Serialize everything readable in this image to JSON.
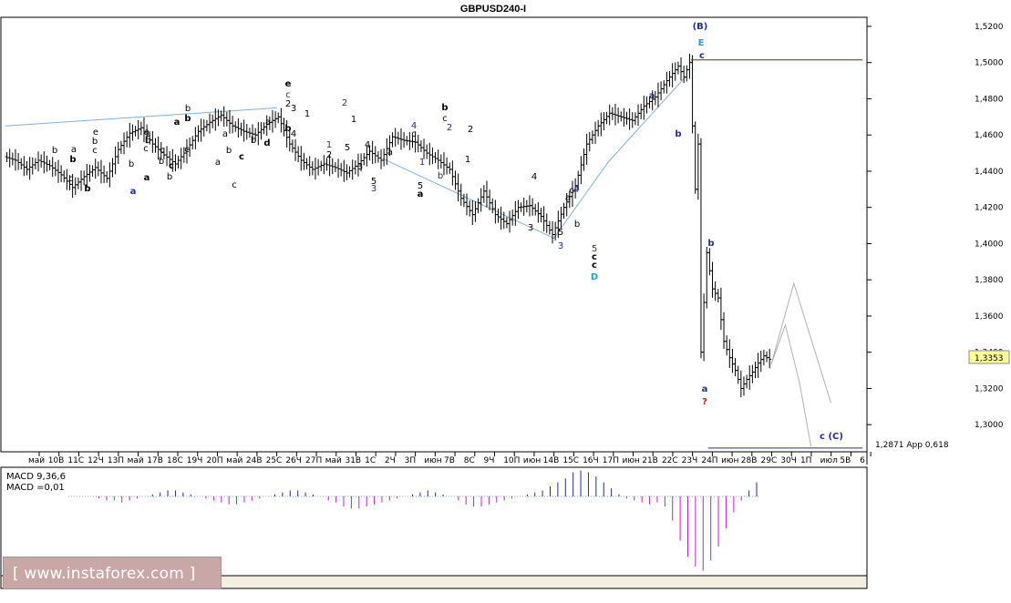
{
  "title": "GBPUSD240-I",
  "price_axis": {
    "ticks": [
      "1,5200",
      "1,5000",
      "1,4800",
      "1,4600",
      "1,4400",
      "1,4200",
      "1,4000",
      "1,3800",
      "1,3600",
      "1,3400",
      "1,3200",
      "1,3000"
    ],
    "current_price": "1,3353"
  },
  "target_label": "1,2871 App 0,618",
  "time_axis": [
    "май",
    "10B",
    "11C",
    "12Ч",
    "13П",
    "май",
    "17B",
    "18C",
    "19Ч",
    "20П",
    "май",
    "24B",
    "25C",
    "26Ч",
    "27П",
    "май",
    "31B",
    "1C",
    "2Ч",
    "3П",
    "июн",
    "7B",
    "8C",
    "9Ч",
    "10П",
    "июн",
    "14B",
    "15C",
    "16Ч",
    "17П",
    "июн",
    "21B",
    "22C",
    "23Ч",
    "24П",
    "июн",
    "28B",
    "29C",
    "30Ч",
    "1П",
    "июл",
    "5B",
    "6"
  ],
  "macd": {
    "label1": "MACD 9,36,6",
    "label2": "MACD =0,01"
  },
  "watermark": "[  www.instaforex.com ]",
  "colors": {
    "background": "#ffffff",
    "wave_blue": "#1f2f8f",
    "wave_dark": "#000000",
    "wave_cyan": "#2aa0c8",
    "question": "#c0201e",
    "resistance_line": "#a01010",
    "macd_neg": "#c020c0",
    "macd_pos": "#1f2f8f"
  },
  "wave_labels": [
    {
      "t": "(B)",
      "c": "wave_blue",
      "b": true
    },
    {
      "t": "E",
      "c": "wave_cyan",
      "b": true
    },
    {
      "t": "c",
      "c": "wave_blue",
      "b": true
    },
    {
      "t": "D",
      "c": "wave_cyan",
      "b": true
    },
    {
      "t": "c",
      "c": "wave_dark",
      "b": true
    },
    {
      "t": "c",
      "c": "wave_dark",
      "b": true
    },
    {
      "t": "5",
      "c": "wave_blue",
      "b": false
    },
    {
      "t": "a",
      "c": "wave_blue",
      "b": true
    },
    {
      "t": "?",
      "c": "question",
      "b": true
    },
    {
      "t": "b",
      "c": "wave_blue",
      "b": true
    },
    {
      "t": "c (C)",
      "c": "wave_blue",
      "b": true
    },
    {
      "t": "a",
      "c": "wave_blue",
      "b": true
    },
    {
      "t": "b",
      "c": "wave_blue",
      "b": true
    },
    {
      "t": "4",
      "c": "wave_blue",
      "b": false
    },
    {
      "t": "3",
      "c": "wave_blue",
      "b": false
    },
    {
      "t": "3",
      "c": "wave_dark",
      "b": false
    },
    {
      "t": "5",
      "c": "wave_dark",
      "b": false
    },
    {
      "t": "4",
      "c": "wave_dark",
      "b": false
    },
    {
      "t": "a",
      "c": "wave_dark",
      "b": false
    },
    {
      "t": "b",
      "c": "wave_dark",
      "b": false
    },
    {
      "t": "c",
      "c": "wave_dark",
      "b": false
    },
    {
      "t": "b",
      "c": "wave_dark",
      "b": true
    },
    {
      "t": "c",
      "c": "wave_dark",
      "b": false
    },
    {
      "t": "2",
      "c": "wave_blue",
      "b": false
    },
    {
      "t": "2",
      "c": "wave_dark",
      "b": false
    },
    {
      "t": "1",
      "c": "wave_dark",
      "b": false
    },
    {
      "t": "1",
      "c": "wave_blue",
      "b": false
    },
    {
      "t": "b",
      "c": "wave_blue",
      "b": false
    },
    {
      "t": "4",
      "c": "wave_blue",
      "b": false
    },
    {
      "t": "c",
      "c": "wave_dark",
      "b": false
    },
    {
      "t": "5",
      "c": "wave_dark",
      "b": false
    },
    {
      "t": "a",
      "c": "wave_dark",
      "b": true
    },
    {
      "t": "4",
      "c": "wave_dark",
      "b": false
    },
    {
      "t": "a",
      "c": "wave_dark",
      "b": false
    },
    {
      "t": "3",
      "c": "wave_dark",
      "b": false
    },
    {
      "t": "5",
      "c": "wave_dark",
      "b": false
    },
    {
      "t": "3",
      "c": "wave_blue",
      "b": false
    },
    {
      "t": "2",
      "c": "wave_blue",
      "b": false
    },
    {
      "t": "1",
      "c": "wave_dark",
      "b": false
    },
    {
      "t": "5",
      "c": "wave_dark",
      "b": false
    },
    {
      "t": "1",
      "c": "wave_blue",
      "b": false
    },
    {
      "t": "2",
      "c": "wave_dark",
      "b": false
    },
    {
      "t": "3",
      "c": "wave_dark",
      "b": false
    },
    {
      "t": "4",
      "c": "wave_dark",
      "b": false
    },
    {
      "t": "1",
      "c": "wave_dark",
      "b": false
    },
    {
      "t": "b",
      "c": "wave_dark",
      "b": true
    },
    {
      "t": "e",
      "c": "wave_dark",
      "b": true
    },
    {
      "t": "c",
      "c": "wave_blue",
      "b": false
    },
    {
      "t": "2",
      "c": "wave_dark",
      "b": false
    },
    {
      "t": "a",
      "c": "wave_dark",
      "b": false
    },
    {
      "t": "b",
      "c": "wave_dark",
      "b": false
    },
    {
      "t": "d",
      "c": "wave_dark",
      "b": true
    },
    {
      "t": "c",
      "c": "wave_dark",
      "b": false
    },
    {
      "t": "c",
      "c": "wave_dark",
      "b": true
    },
    {
      "t": "a",
      "c": "wave_dark",
      "b": false
    },
    {
      "t": "b",
      "c": "wave_dark",
      "b": false
    },
    {
      "t": "a",
      "c": "wave_dark",
      "b": false
    },
    {
      "t": "b",
      "c": "wave_dark",
      "b": false
    },
    {
      "t": "b",
      "c": "wave_dark",
      "b": true
    },
    {
      "t": "a",
      "c": "wave_dark",
      "b": true
    },
    {
      "t": "c",
      "c": "wave_dark",
      "b": false
    },
    {
      "t": "b",
      "c": "wave_dark",
      "b": false
    },
    {
      "t": "c",
      "c": "wave_dark",
      "b": true
    },
    {
      "t": "a",
      "c": "wave_blue",
      "b": true
    },
    {
      "t": "b",
      "c": "wave_dark",
      "b": false
    },
    {
      "t": "c",
      "c": "wave_dark",
      "b": false
    },
    {
      "t": "a",
      "c": "wave_dark",
      "b": false
    },
    {
      "t": "b",
      "c": "wave_dark",
      "b": false
    },
    {
      "t": "a",
      "c": "wave_dark",
      "b": true
    },
    {
      "t": "b",
      "c": "wave_dark",
      "b": false
    },
    {
      "t": "c",
      "c": "wave_dark",
      "b": false
    },
    {
      "t": "e",
      "c": "wave_dark",
      "b": false
    },
    {
      "t": "b",
      "c": "wave_dark",
      "b": false
    },
    {
      "t": "c",
      "c": "wave_dark",
      "b": false
    },
    {
      "t": "b",
      "c": "wave_dark",
      "b": true
    },
    {
      "t": "a",
      "c": "wave_dark",
      "b": false
    },
    {
      "t": "b",
      "c": "wave_dark",
      "b": true
    },
    {
      "t": "c",
      "c": "wave_dark",
      "b": false
    },
    {
      "t": "b",
      "c": "wave_dark",
      "b": false
    }
  ],
  "chart_data": {
    "type": "candlestick-ohlc",
    "title": "GBPUSD240-I",
    "timeframe": "H4",
    "y_range": [
      1.285,
      1.525
    ],
    "price_ticks": [
      1.52,
      1.5,
      1.48,
      1.46,
      1.44,
      1.42,
      1.4,
      1.38,
      1.36,
      1.34,
      1.32,
      1.3
    ],
    "last_price": 1.3353,
    "key_levels": [
      {
        "price": 1.5015,
        "role": "wave (B) high"
      },
      {
        "price": 1.2871,
        "label": "1,2871 App 0,618"
      }
    ],
    "path_points": [
      {
        "x": 0,
        "y": 1.448
      },
      {
        "x": 4,
        "y": 1.446
      },
      {
        "x": 8,
        "y": 1.441
      },
      {
        "x": 12,
        "y": 1.446
      },
      {
        "x": 16,
        "y": 1.443
      },
      {
        "x": 20,
        "y": 1.438
      },
      {
        "x": 24,
        "y": 1.431
      },
      {
        "x": 28,
        "y": 1.437
      },
      {
        "x": 32,
        "y": 1.442
      },
      {
        "x": 36,
        "y": 1.436
      },
      {
        "x": 40,
        "y": 1.452
      },
      {
        "x": 44,
        "y": 1.461
      },
      {
        "x": 48,
        "y": 1.464
      },
      {
        "x": 52,
        "y": 1.455
      },
      {
        "x": 56,
        "y": 1.449
      },
      {
        "x": 60,
        "y": 1.444
      },
      {
        "x": 64,
        "y": 1.452
      },
      {
        "x": 68,
        "y": 1.462
      },
      {
        "x": 72,
        "y": 1.467
      },
      {
        "x": 76,
        "y": 1.471
      },
      {
        "x": 80,
        "y": 1.465
      },
      {
        "x": 84,
        "y": 1.462
      },
      {
        "x": 88,
        "y": 1.46
      },
      {
        "x": 92,
        "y": 1.466
      },
      {
        "x": 96,
        "y": 1.47
      },
      {
        "x": 100,
        "y": 1.455
      },
      {
        "x": 104,
        "y": 1.446
      },
      {
        "x": 108,
        "y": 1.441
      },
      {
        "x": 112,
        "y": 1.444
      },
      {
        "x": 116,
        "y": 1.442
      },
      {
        "x": 120,
        "y": 1.439
      },
      {
        "x": 124,
        "y": 1.444
      },
      {
        "x": 128,
        "y": 1.451
      },
      {
        "x": 132,
        "y": 1.446
      },
      {
        "x": 136,
        "y": 1.459
      },
      {
        "x": 140,
        "y": 1.457
      },
      {
        "x": 144,
        "y": 1.456
      },
      {
        "x": 148,
        "y": 1.45
      },
      {
        "x": 152,
        "y": 1.446
      },
      {
        "x": 156,
        "y": 1.441
      },
      {
        "x": 160,
        "y": 1.425
      },
      {
        "x": 164,
        "y": 1.416
      },
      {
        "x": 168,
        "y": 1.429
      },
      {
        "x": 172,
        "y": 1.416
      },
      {
        "x": 176,
        "y": 1.411
      },
      {
        "x": 180,
        "y": 1.42
      },
      {
        "x": 184,
        "y": 1.421
      },
      {
        "x": 188,
        "y": 1.415
      },
      {
        "x": 192,
        "y": 1.405
      },
      {
        "x": 196,
        "y": 1.42
      },
      {
        "x": 200,
        "y": 1.432
      },
      {
        "x": 204,
        "y": 1.455
      },
      {
        "x": 208,
        "y": 1.465
      },
      {
        "x": 212,
        "y": 1.472
      },
      {
        "x": 216,
        "y": 1.47
      },
      {
        "x": 220,
        "y": 1.468
      },
      {
        "x": 224,
        "y": 1.476
      },
      {
        "x": 228,
        "y": 1.481
      },
      {
        "x": 232,
        "y": 1.49
      },
      {
        "x": 236,
        "y": 1.498
      },
      {
        "x": 238,
        "y": 1.492
      },
      {
        "x": 240,
        "y": 1.5
      },
      {
        "x": 242,
        "y": 1.43
      },
      {
        "x": 243,
        "y": 1.455
      },
      {
        "x": 244,
        "y": 1.34
      },
      {
        "x": 246,
        "y": 1.395
      },
      {
        "x": 248,
        "y": 1.375
      },
      {
        "x": 250,
        "y": 1.37
      },
      {
        "x": 252,
        "y": 1.346
      },
      {
        "x": 254,
        "y": 1.337
      },
      {
        "x": 256,
        "y": 1.33
      },
      {
        "x": 258,
        "y": 1.32
      },
      {
        "x": 260,
        "y": 1.325
      },
      {
        "x": 262,
        "y": 1.329
      },
      {
        "x": 264,
        "y": 1.334
      },
      {
        "x": 266,
        "y": 1.338
      },
      {
        "x": 268,
        "y": 1.336
      }
    ],
    "wave_channel_lines": [
      [
        {
          "x": 0,
          "y": 1.465
        },
        {
          "x": 95,
          "y": 1.475
        }
      ],
      [
        {
          "x": 132,
          "y": 1.447
        },
        {
          "x": 192,
          "y": 1.403
        },
        {
          "x": 211,
          "y": 1.445
        },
        {
          "x": 238,
          "y": 1.492
        }
      ]
    ],
    "projection_path": [
      {
        "x": 268,
        "y": 1.333
      },
      {
        "x": 273,
        "y": 1.355
      },
      {
        "x": 278,
        "y": 1.323
      },
      {
        "x": 282,
        "y": 1.288
      }
    ],
    "projection_path_alt": [
      {
        "x": 268,
        "y": 1.333
      },
      {
        "x": 276,
        "y": 1.378
      },
      {
        "x": 289,
        "y": 1.312
      }
    ],
    "macd": {
      "params": "MACD 9,36,6",
      "value": 0.01,
      "bars": [
        0,
        0,
        0,
        0,
        -1,
        -2,
        -2,
        -3,
        -2,
        -1,
        0,
        1,
        2,
        3,
        3,
        2,
        1,
        0,
        -1,
        -2,
        -3,
        -4,
        -4,
        -3,
        -2,
        -1,
        0,
        1,
        2,
        3,
        3,
        2,
        1,
        0,
        -2,
        -3,
        -5,
        -6,
        -6,
        -5,
        -4,
        -3,
        -2,
        -1,
        0,
        1,
        2,
        3,
        2,
        1,
        0,
        -2,
        -4,
        -5,
        -5,
        -4,
        -3,
        -2,
        -1,
        0,
        1,
        2,
        3,
        5,
        7,
        9,
        12,
        13,
        12,
        10,
        7,
        4,
        1,
        -1,
        -2,
        -3,
        -4,
        -3,
        -5,
        -12,
        -22,
        -30,
        -35,
        -37,
        -32,
        -25,
        -16,
        -8,
        -2,
        3,
        7
      ]
    }
  }
}
